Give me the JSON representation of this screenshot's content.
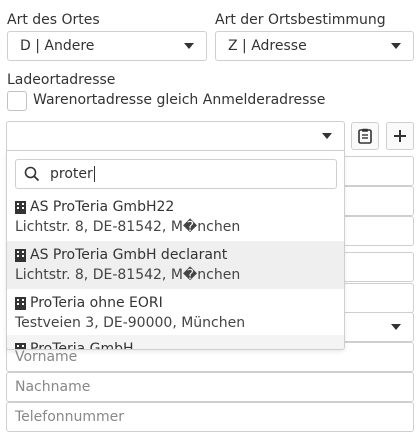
{
  "fields": {
    "art_des_ortes_label": "Art des Ortes",
    "art_des_ortes_value": "D | Andere",
    "art_ortsbestimmung_label": "Art der Ortsbestimmung",
    "art_ortsbestimmung_value": "Z | Adresse",
    "ladeort_label": "Ladeortadresse",
    "waren_checkbox_label": "Warenortadresse gleich Anmelderadresse",
    "ladeort_select_value": ""
  },
  "dropdown": {
    "search_value": "proter",
    "options": [
      {
        "name": "AS ProTeria GmbH22",
        "address": "Lichtstr. 8, DE-81542, M�nchen"
      },
      {
        "name": "AS ProTeria GmbH declarant",
        "address": "Lichtstr. 8, DE-81542, M�nchen"
      },
      {
        "name": "ProTeria ohne EORI",
        "address": "Testveien 3, DE-90000, München"
      },
      {
        "name": "ProTeria GmbH",
        "address": ""
      }
    ]
  },
  "form_below": {
    "vorname_placeholder": "Vorname",
    "nachname_placeholder": "Nachname",
    "telefon_placeholder": "Telefonnummer"
  },
  "icons": {
    "copy_button": "clipboard-icon",
    "add_button": "plus-icon",
    "search": "search-icon",
    "company": "building-icon"
  }
}
